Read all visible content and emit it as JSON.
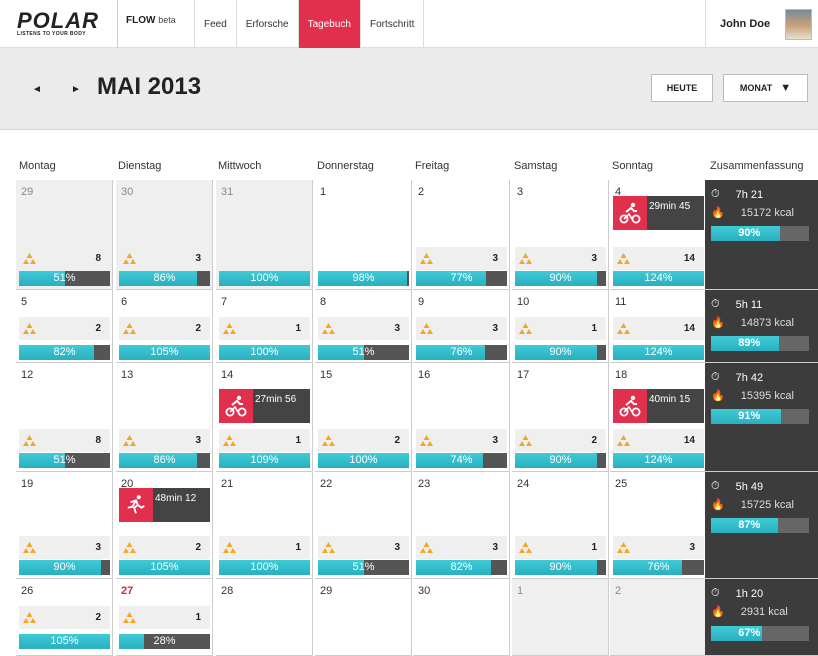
{
  "brand": {
    "logo": "POLAR",
    "tagline": "LISTENS TO YOUR BODY",
    "flow": "FLOW",
    "flow_suffix": "beta"
  },
  "nav": [
    "Feed",
    "Erforsche",
    "Tagebuch",
    "Fortschritt"
  ],
  "nav_active": 2,
  "user": {
    "name": "John Doe"
  },
  "header": {
    "prev": "◄",
    "next": "►",
    "month": "MAI 2013",
    "today": "HEUTE",
    "view": "MONAT",
    "view_icon": "▼"
  },
  "days": [
    "Montag",
    "Dienstag",
    "Mittwoch",
    "Donnerstag",
    "Freitag",
    "Samstag",
    "Sonntag",
    "Zusammenfassung"
  ],
  "colors": {
    "accent": "#e0304e",
    "bar": "#2db5c6",
    "dark": "#3c3c3c"
  },
  "weeks": [
    {
      "cells": [
        {
          "d": "29",
          "other": true,
          "a": "8",
          "p": "51%",
          "f": 0.51
        },
        {
          "d": "30",
          "other": true,
          "a": "3",
          "p": "86%",
          "f": 0.86
        },
        {
          "d": "31",
          "other": true,
          "p": "100%",
          "f": 1.0
        },
        {
          "d": "1",
          "p": "98%",
          "f": 0.98
        },
        {
          "d": "2",
          "a": "3",
          "p": "77%",
          "f": 0.77
        },
        {
          "d": "3",
          "a": "3",
          "p": "90%",
          "f": 0.9
        },
        {
          "d": "4",
          "s": "29min 45",
          "si": "bike",
          "a": "14",
          "p": "124%",
          "f": 1.0
        }
      ],
      "sum": {
        "time": "7h 21",
        "kcal": "15172 kcal",
        "pct": "90%",
        "f": 0.9
      }
    },
    {
      "cells": [
        {
          "d": "5",
          "a": "2",
          "p": "82%",
          "f": 0.82
        },
        {
          "d": "6",
          "a": "2",
          "p": "105%",
          "f": 1.0
        },
        {
          "d": "7",
          "a": "1",
          "p": "100%",
          "f": 1.0
        },
        {
          "d": "8",
          "a": "3",
          "p": "51%",
          "f": 0.51
        },
        {
          "d": "9",
          "a": "3",
          "p": "76%",
          "f": 0.76
        },
        {
          "d": "10",
          "a": "1",
          "p": "90%",
          "f": 0.9
        },
        {
          "d": "11",
          "a": "14",
          "p": "124%",
          "f": 1.0
        }
      ],
      "sum": {
        "time": "5h 11",
        "kcal": "14873 kcal",
        "pct": "89%",
        "f": 0.89
      }
    },
    {
      "cells": [
        {
          "d": "12",
          "a": "8",
          "p": "51%",
          "f": 0.51
        },
        {
          "d": "13",
          "a": "3",
          "p": "86%",
          "f": 0.86
        },
        {
          "d": "14",
          "s": "27min 56",
          "si": "bike",
          "a": "1",
          "p": "109%",
          "f": 1.0
        },
        {
          "d": "15",
          "a": "2",
          "p": "100%",
          "f": 1.0
        },
        {
          "d": "16",
          "a": "3",
          "p": "74%",
          "f": 0.74
        },
        {
          "d": "17",
          "a": "2",
          "p": "90%",
          "f": 0.9
        },
        {
          "d": "18",
          "s": "40min 15",
          "si": "bike",
          "a": "14",
          "p": "124%",
          "f": 1.0
        }
      ],
      "sum": {
        "time": "7h 42",
        "kcal": "15395 kcal",
        "pct": "91%",
        "f": 0.91
      }
    },
    {
      "cells": [
        {
          "d": "19",
          "a": "3",
          "p": "90%",
          "f": 0.9
        },
        {
          "d": "20",
          "s": "48min 12",
          "si": "run",
          "a": "2",
          "p": "105%",
          "f": 1.0
        },
        {
          "d": "21",
          "a": "1",
          "p": "100%",
          "f": 1.0
        },
        {
          "d": "22",
          "a": "3",
          "p": "51%",
          "f": 0.51
        },
        {
          "d": "23",
          "a": "3",
          "p": "82%",
          "f": 0.82
        },
        {
          "d": "24",
          "a": "1",
          "p": "90%",
          "f": 0.9
        },
        {
          "d": "25",
          "a": "3",
          "p": "76%",
          "f": 0.76
        }
      ],
      "sum": {
        "time": "5h 49",
        "kcal": "15725 kcal",
        "pct": "87%",
        "f": 0.87
      }
    },
    {
      "cells": [
        {
          "d": "26",
          "a": "2",
          "p": "105%",
          "f": 1.0
        },
        {
          "d": "27",
          "red": true,
          "a": "1",
          "p": "28%",
          "f": 0.28
        },
        {
          "d": "28"
        },
        {
          "d": "29"
        },
        {
          "d": "30"
        },
        {
          "d": "1",
          "other": true
        },
        {
          "d": "2",
          "other": true
        }
      ],
      "sum": {
        "time": "1h 20",
        "kcal": "2931 kcal",
        "pct": "67%",
        "f": 0.67
      }
    }
  ]
}
